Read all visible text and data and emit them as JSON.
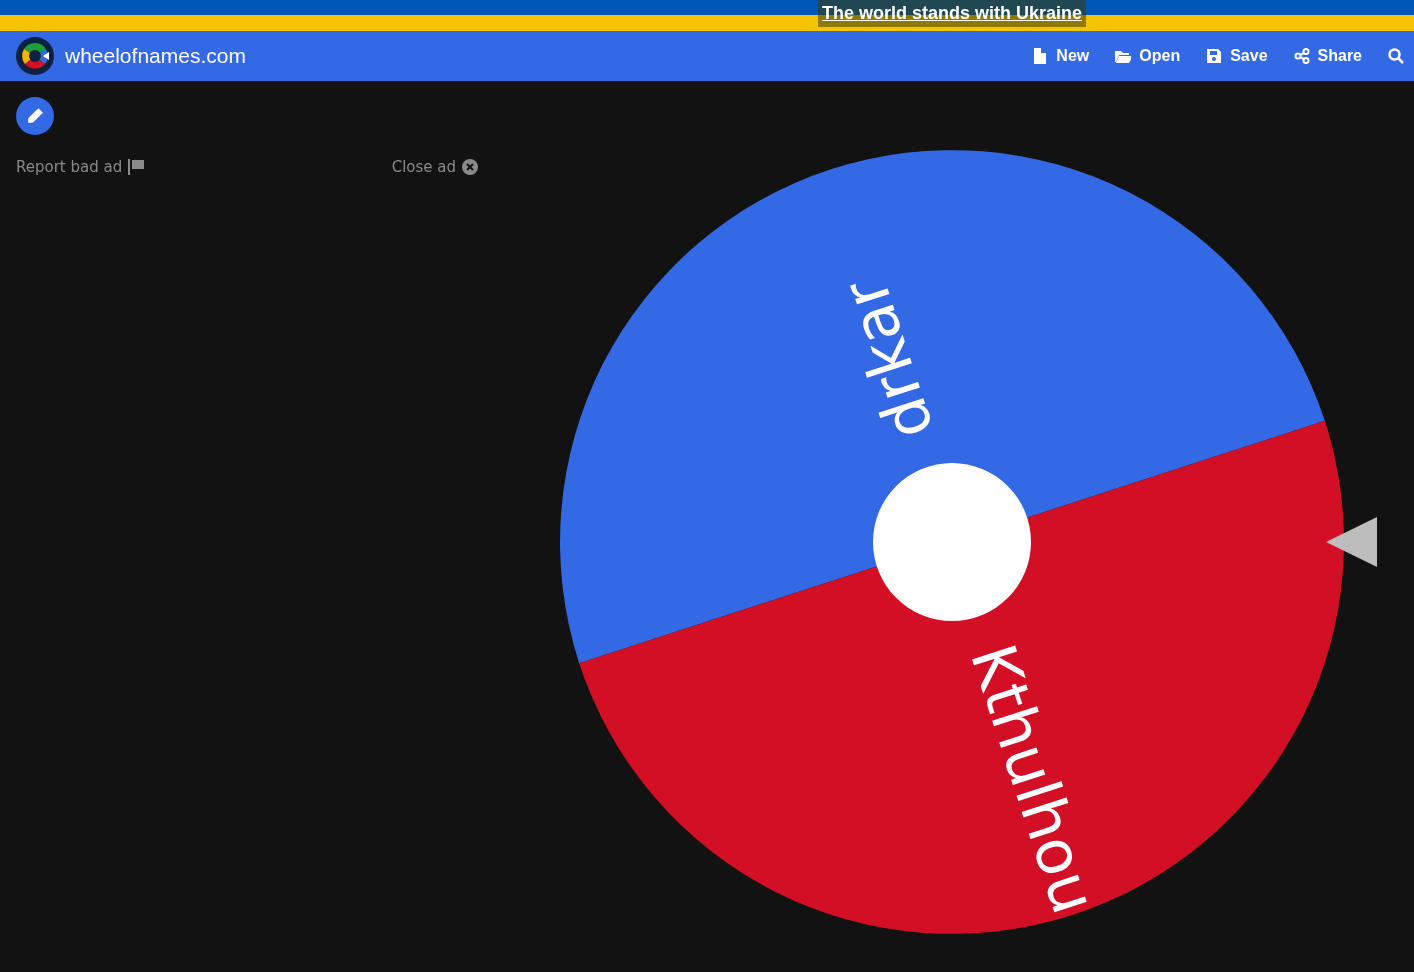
{
  "banner": {
    "text": "The world stands with Ukraine"
  },
  "header": {
    "site_name": "wheelofnames.com",
    "menu": [
      {
        "kind": "new",
        "label": "New"
      },
      {
        "kind": "open",
        "label": "Open"
      },
      {
        "kind": "save",
        "label": "Save"
      },
      {
        "kind": "share",
        "label": "Share"
      },
      {
        "kind": "search"
      }
    ]
  },
  "ad": {
    "report": "Report bad ad",
    "close": "Close ad"
  },
  "wheel": {
    "segments": [
      {
        "label": "drkar",
        "color": "#3469e6"
      },
      {
        "label": "Kthulhou",
        "color": "#d30f25"
      }
    ]
  }
}
